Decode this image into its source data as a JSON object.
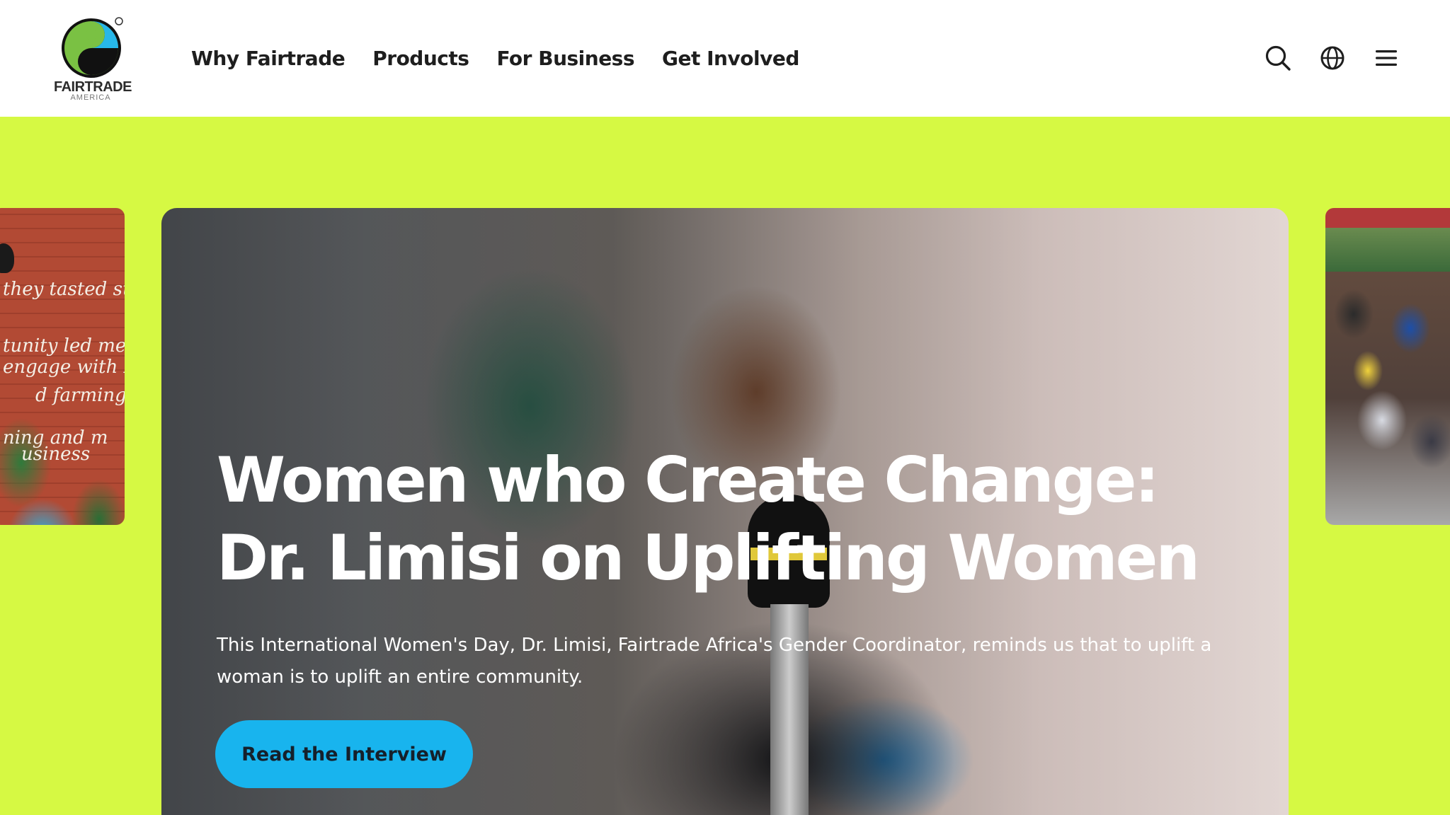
{
  "header": {
    "logo": {
      "wordmark": "FAIRTRADE",
      "sub": "AMERICA",
      "colors": {
        "blue": "#27b7e9",
        "green": "#7ac143",
        "black": "#111111"
      }
    },
    "nav": [
      {
        "label": "Why Fairtrade"
      },
      {
        "label": "Products"
      },
      {
        "label": "For Business"
      },
      {
        "label": "Get Involved"
      }
    ],
    "icons": {
      "search": "search-icon",
      "language": "globe-icon",
      "menu": "menu-icon"
    }
  },
  "carousel": {
    "left_slide": {
      "wall_text": [
        "they tasted su",
        "tunity led me",
        "engage with Fair",
        "d farming",
        "ning and m",
        "usiness"
      ]
    },
    "active_slide": {
      "title": "Women who Create Change: Dr. Limisi on Uplifting Women",
      "description": "This International Women's Day, Dr. Limisi, Fairtrade Africa's Gender Coordinator, reminds us that to uplift a woman is to uplift an entire community.",
      "cta": "Read the Interview"
    }
  },
  "theme": {
    "background": "#d6f943",
    "header_bg": "#ffffff",
    "cta_bg": "#18b4ee",
    "text_dark": "#1e1e1e"
  }
}
